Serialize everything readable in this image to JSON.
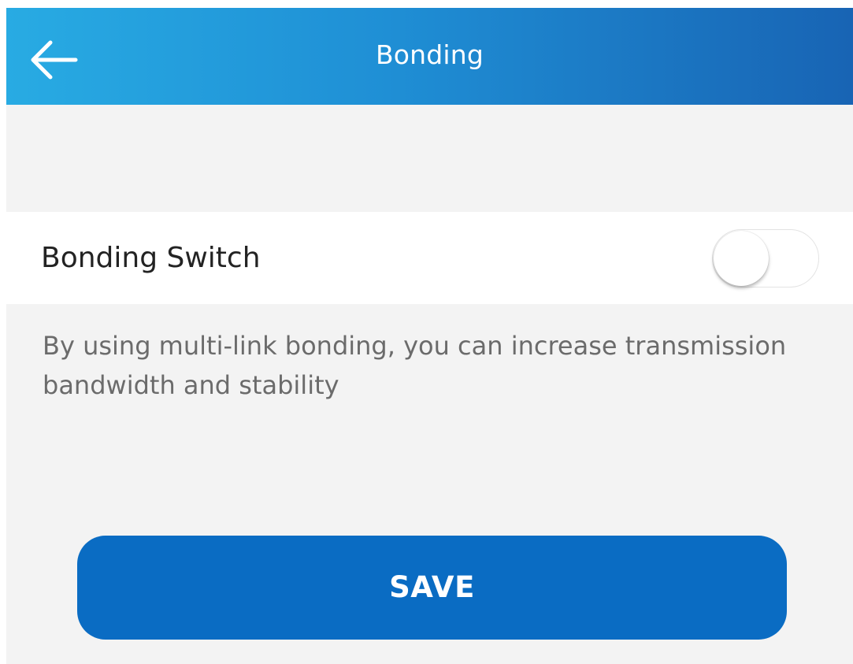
{
  "header": {
    "title": "Bonding",
    "back_icon": "arrow-left-icon",
    "gradient_start": "#28abe3",
    "gradient_end": "#1864b4"
  },
  "bonding": {
    "label": "Bonding Switch",
    "enabled": false,
    "description": "By using multi-link bonding, you can increase transmission bandwidth and stability"
  },
  "actions": {
    "save_label": "SAVE",
    "button_color": "#0a6cc3"
  }
}
